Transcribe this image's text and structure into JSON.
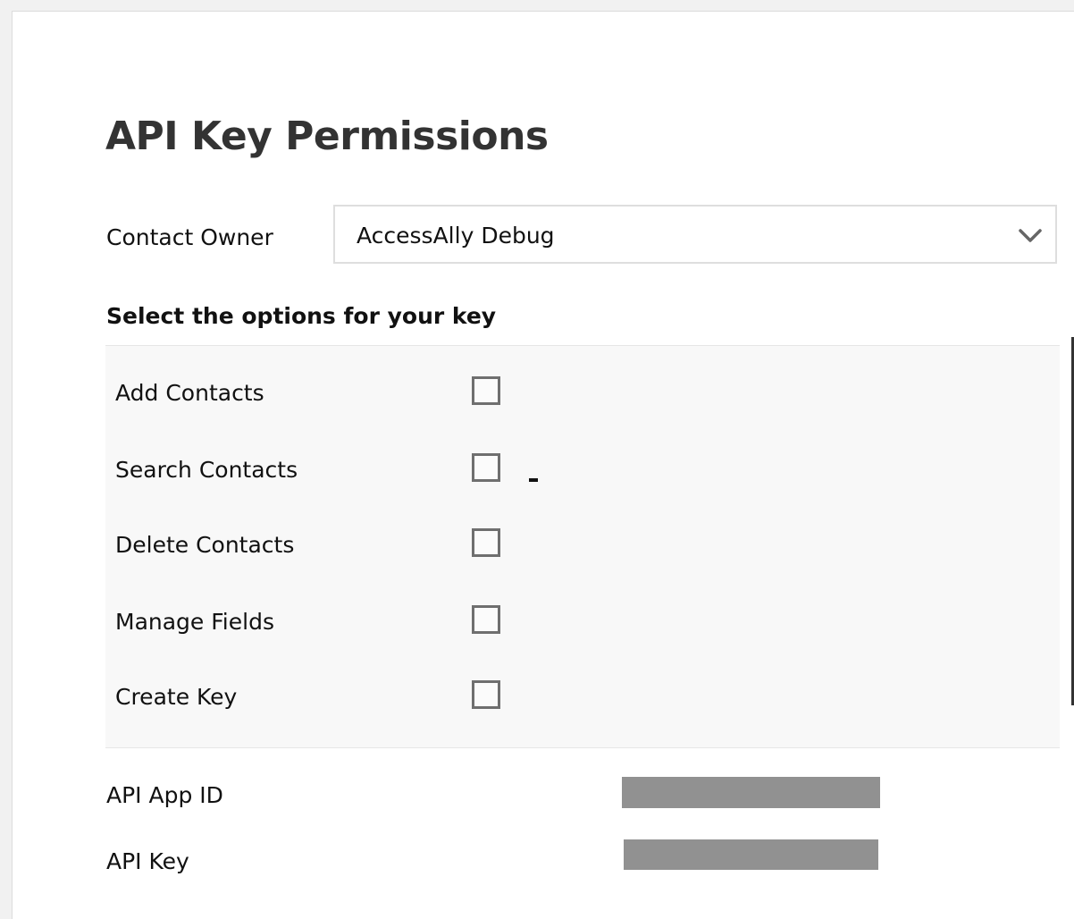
{
  "page": {
    "title": "API Key Permissions"
  },
  "contact_owner": {
    "label": "Contact Owner",
    "selected": "AccessAlly Debug"
  },
  "options": {
    "heading": "Select the options for your key",
    "items": [
      {
        "label": "Add Contacts",
        "checked": false
      },
      {
        "label": "Search Contacts",
        "checked": false
      },
      {
        "label": "Delete Contacts",
        "checked": false
      },
      {
        "label": "Manage Fields",
        "checked": false
      },
      {
        "label": "Create Key",
        "checked": false
      }
    ]
  },
  "credentials": {
    "app_id_label": "API App ID",
    "key_label": "API Key"
  },
  "colors": {
    "title": "#333333",
    "checkbox_border": "#6f6f6f",
    "options_background": "#f8f8f8",
    "redaction": "#919191"
  },
  "icons": {
    "dropdown": "chevron-down-icon"
  }
}
